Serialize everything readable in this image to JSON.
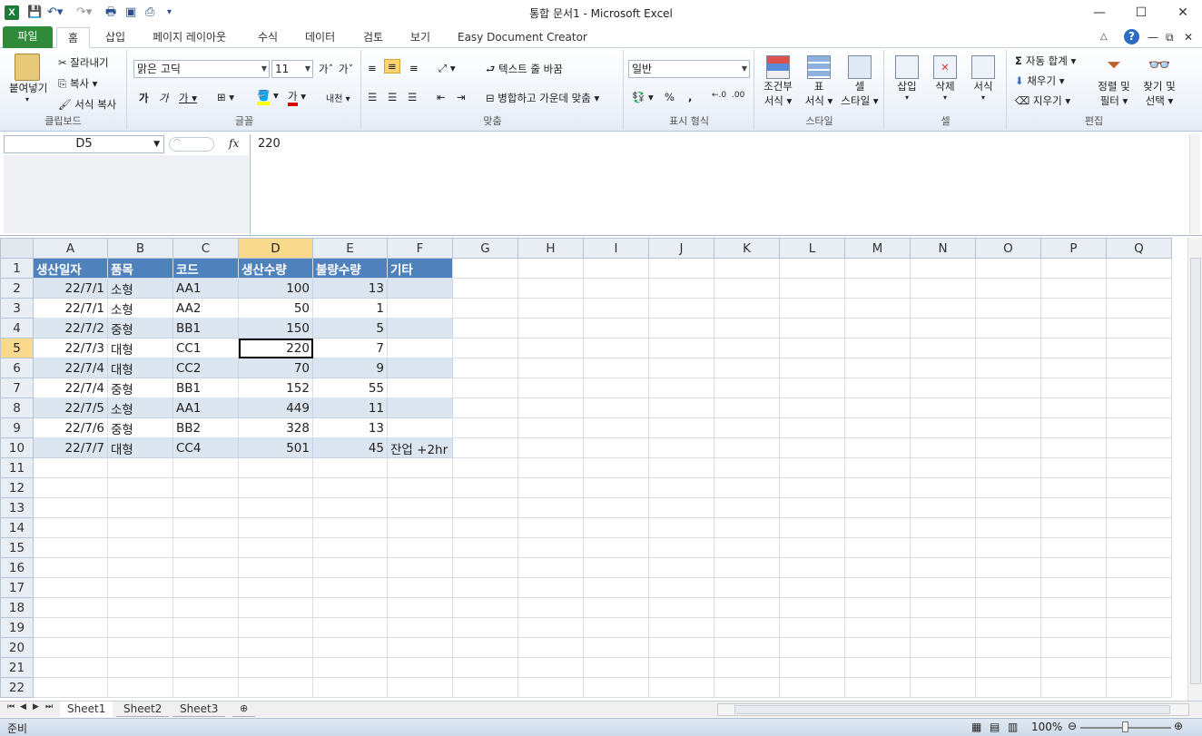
{
  "window": {
    "title": "통합 문서1  -  Microsoft Excel",
    "controls": [
      "minimize",
      "maximize",
      "close"
    ]
  },
  "ribbon_tabs": [
    "파일",
    "홈",
    "삽입",
    "페이지 레이아웃",
    "수식",
    "데이터",
    "검토",
    "보기",
    "Easy Document Creator"
  ],
  "ribbon": {
    "clipboard": {
      "paste": "붙여넣기",
      "cut": "잘라내기",
      "copy": "복사",
      "format_painter": "서식 복사",
      "label": "클립보드"
    },
    "font": {
      "font_name": "맑은 고딕",
      "font_size": "11",
      "label": "글꼴"
    },
    "alignment": {
      "wrap_text": "텍스트 줄 바꿈",
      "merge_center": "병합하고 가운데 맞춤",
      "label": "맞춤"
    },
    "number": {
      "format": "일반",
      "label": "표시 형식"
    },
    "styles": {
      "conditional": [
        "조건부",
        "서식"
      ],
      "table": [
        "표",
        "서식"
      ],
      "cell_style": [
        "셀",
        "스타일"
      ],
      "label": "스타일"
    },
    "cells": {
      "insert": "삽입",
      "delete": "삭제",
      "format": "서식",
      "label": "셀"
    },
    "editing": {
      "autosum": "자동 합계",
      "fill": "채우기",
      "clear": "지우기",
      "sort": [
        "정렬 및",
        "필터"
      ],
      "find": [
        "찾기 및",
        "선택"
      ],
      "label": "편집"
    }
  },
  "formula_bar": {
    "name_box": "D5",
    "fx": "fx",
    "formula": "220"
  },
  "grid": {
    "columns": [
      "A",
      "B",
      "C",
      "D",
      "E",
      "F",
      "G",
      "H",
      "I",
      "J",
      "K",
      "L",
      "M",
      "N",
      "O",
      "P",
      "Q"
    ],
    "selected_column": "D",
    "selected_row": 5,
    "row_count": 22,
    "header_row": [
      "생산일자",
      "품목",
      "코드",
      "생산수량",
      "불량수량",
      "기타"
    ],
    "rows": [
      [
        "22/7/1",
        "소형",
        "AA1",
        "100",
        "13",
        ""
      ],
      [
        "22/7/1",
        "소형",
        "AA2",
        "50",
        "1",
        ""
      ],
      [
        "22/7/2",
        "중형",
        "BB1",
        "150",
        "5",
        ""
      ],
      [
        "22/7/3",
        "대형",
        "CC1",
        "220",
        "7",
        ""
      ],
      [
        "22/7/4",
        "대형",
        "CC2",
        "70",
        "9",
        ""
      ],
      [
        "22/7/4",
        "중형",
        "BB1",
        "152",
        "55",
        ""
      ],
      [
        "22/7/5",
        "소형",
        "AA1",
        "449",
        "11",
        ""
      ],
      [
        "22/7/6",
        "중형",
        "BB2",
        "328",
        "13",
        ""
      ],
      [
        "22/7/7",
        "대형",
        "CC4",
        "501",
        "45",
        "잔업 +2hr"
      ]
    ]
  },
  "sheets": [
    "Sheet1",
    "Sheet2",
    "Sheet3"
  ],
  "active_sheet": "Sheet1",
  "status": {
    "ready": "준비",
    "zoom": "100%"
  }
}
